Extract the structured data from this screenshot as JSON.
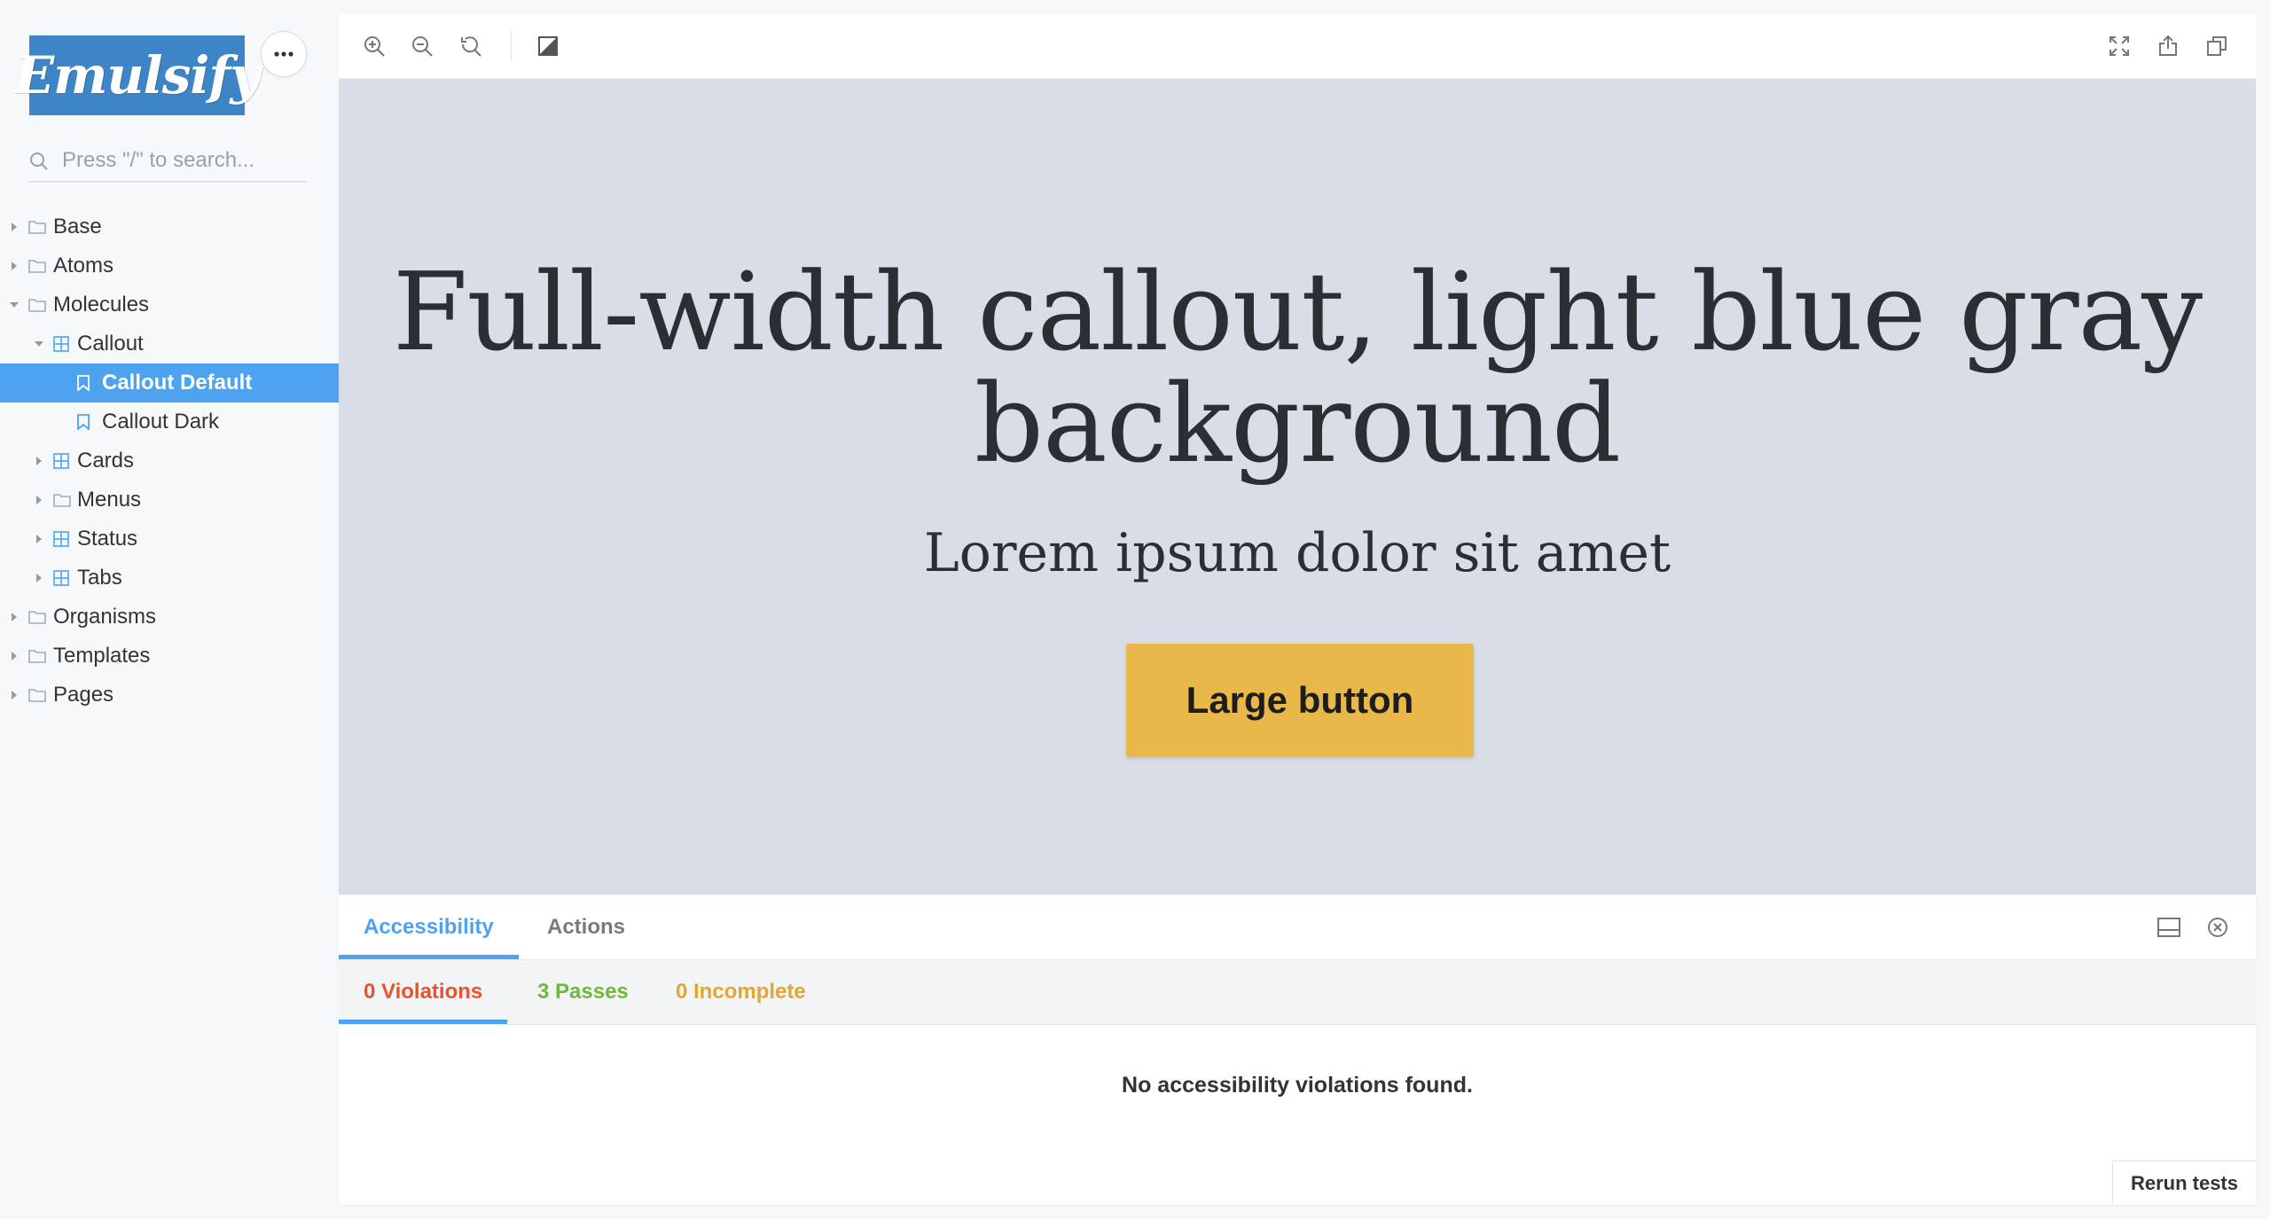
{
  "sidebar": {
    "logo_text": "Emulsify",
    "menu_icon": "ellipsis-icon",
    "search_placeholder": "Press \"/\" to search...",
    "tree": [
      {
        "label": "Base",
        "kind": "folder",
        "expanded": false
      },
      {
        "label": "Atoms",
        "kind": "folder",
        "expanded": false
      },
      {
        "label": "Molecules",
        "kind": "folder",
        "expanded": true
      },
      {
        "label": "Callout",
        "kind": "component",
        "expanded": true
      },
      {
        "label": "Callout Default",
        "kind": "story",
        "selected": true
      },
      {
        "label": "Callout Dark",
        "kind": "story"
      },
      {
        "label": "Cards",
        "kind": "component",
        "expanded": false
      },
      {
        "label": "Menus",
        "kind": "folder",
        "expanded": false
      },
      {
        "label": "Status",
        "kind": "component",
        "expanded": false
      },
      {
        "label": "Tabs",
        "kind": "component",
        "expanded": false
      },
      {
        "label": "Organisms",
        "kind": "folder",
        "expanded": false
      },
      {
        "label": "Templates",
        "kind": "folder",
        "expanded": false
      },
      {
        "label": "Pages",
        "kind": "folder",
        "expanded": false
      }
    ]
  },
  "toolbar": {
    "icons_left": [
      "zoom-in-icon",
      "zoom-out-icon",
      "zoom-reset-icon",
      "background-contrast-icon"
    ],
    "icons_right": [
      "fullscreen-icon",
      "share-icon",
      "copy-link-icon"
    ]
  },
  "preview": {
    "callout_title": "Full-width callout, light blue gray background",
    "callout_subtitle": "Lorem ipsum dolor sit amet",
    "button_label": "Large button"
  },
  "panel": {
    "tabs": [
      "Accessibility",
      "Actions"
    ],
    "active_tab": "Accessibility",
    "a11y_tabs": {
      "violations": "0 Violations",
      "passes": "3 Passes",
      "incomplete": "0 Incomplete"
    },
    "empty_message": "No accessibility violations found.",
    "rerun_label": "Rerun tests"
  },
  "colors": {
    "accent": "#4ea3f1",
    "logo_bg": "#3d85c6",
    "preview_bg": "#d8dde6",
    "button_bg": "#e8b84b",
    "violations": "#e8532d",
    "passes": "#70b73c",
    "incomplete": "#e4a72c"
  }
}
